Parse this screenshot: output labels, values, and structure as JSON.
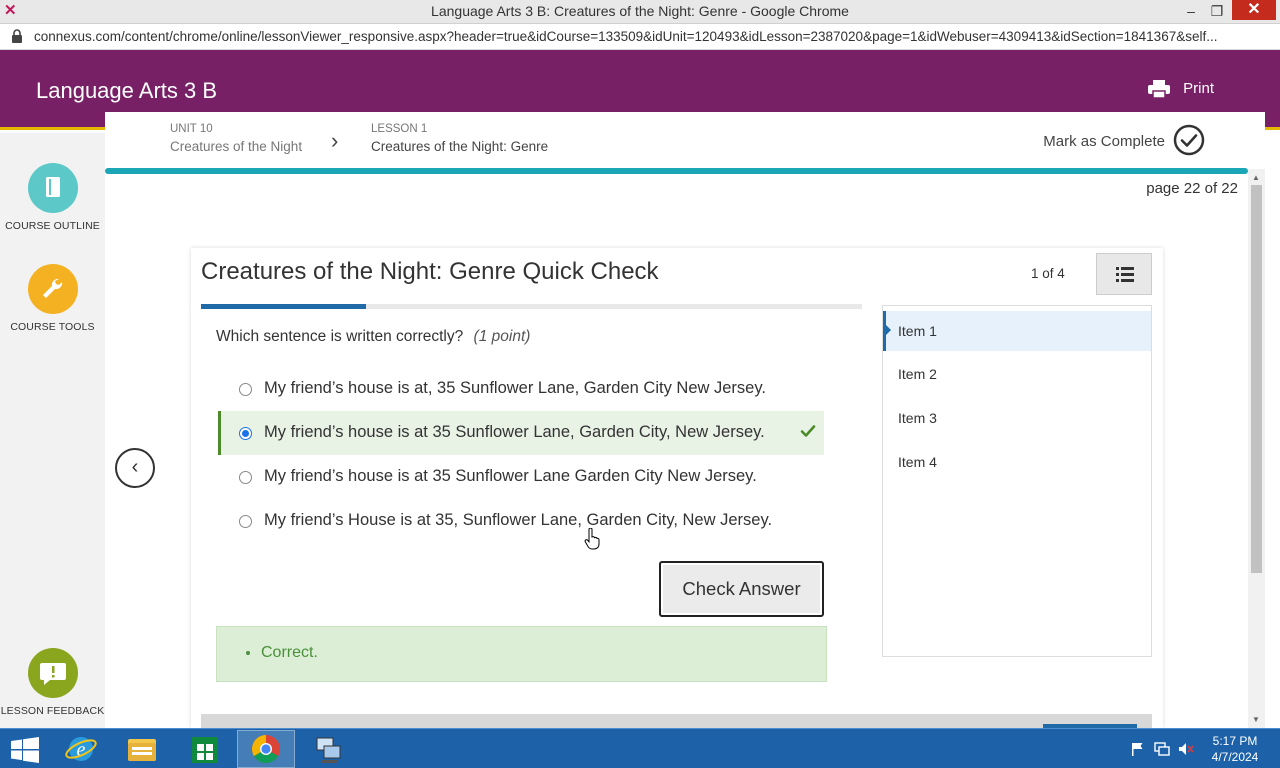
{
  "window": {
    "title": "Language Arts 3 B: Creatures of the Night: Genre - Google Chrome",
    "minimize": "–",
    "maximize": "❐",
    "close": "✕"
  },
  "address_bar": {
    "url": "connexus.com/content/chrome/online/lessonViewer_responsive.aspx?header=true&idCourse=133509&idUnit=120493&idLesson=2387020&page=1&idWebuser=4309413&idSection=1841367&self..."
  },
  "course_header": {
    "title": "Language Arts 3 B",
    "print_label": "Print"
  },
  "left_rail": {
    "course_outline": "COURSE OUTLINE",
    "course_tools": "COURSE TOOLS",
    "lesson_feedback": "LESSON FEEDBACK"
  },
  "breadcrumb": {
    "unit_label": "UNIT 10",
    "unit_name": "Creatures of the Night",
    "lesson_label": "LESSON 1",
    "lesson_name": "Creatures of the Night: Genre"
  },
  "mark_complete_label": "Mark as Complete",
  "page_indicator": "page 22 of 22",
  "quiz": {
    "title": "Creatures of the Night: Genre Quick Check",
    "count": "1 of 4",
    "progress": 0.25,
    "question": "Which sentence is written correctly?",
    "points": "(1 point)",
    "options": [
      {
        "text": "My friend’s house is at, 35 Sunflower Lane, Garden City New Jersey.",
        "selected": false
      },
      {
        "text": "My friend’s house is at 35 Sunflower Lane, Garden City, New Jersey.",
        "selected": true
      },
      {
        "text": "My friend’s house is at 35 Sunflower Lane Garden City New Jersey.",
        "selected": false
      },
      {
        "text": "My friend’s House is at 35, Sunflower Lane, Garden City, New Jersey.",
        "selected": false
      }
    ],
    "check_button": "Check Answer",
    "feedback": "Correct.",
    "items": [
      "Item 1",
      "Item 2",
      "Item 3",
      "Item 4"
    ]
  },
  "taskbar": {
    "time": "5:17 PM",
    "date": "4/7/2024"
  },
  "colors": {
    "brand_purple": "#782066",
    "accent_gold": "#e5b700",
    "progress_teal": "#1aa6b7",
    "quiz_blue": "#1f6aa7",
    "correct_green": "#4c8a2a",
    "taskbar_blue": "#1d62a8"
  },
  "icons": {
    "course_outline": "book-icon",
    "course_tools": "wrench-icon",
    "lesson_feedback": "chat-alert-icon",
    "print": "printer-icon",
    "mark_complete": "check-circle-icon"
  }
}
